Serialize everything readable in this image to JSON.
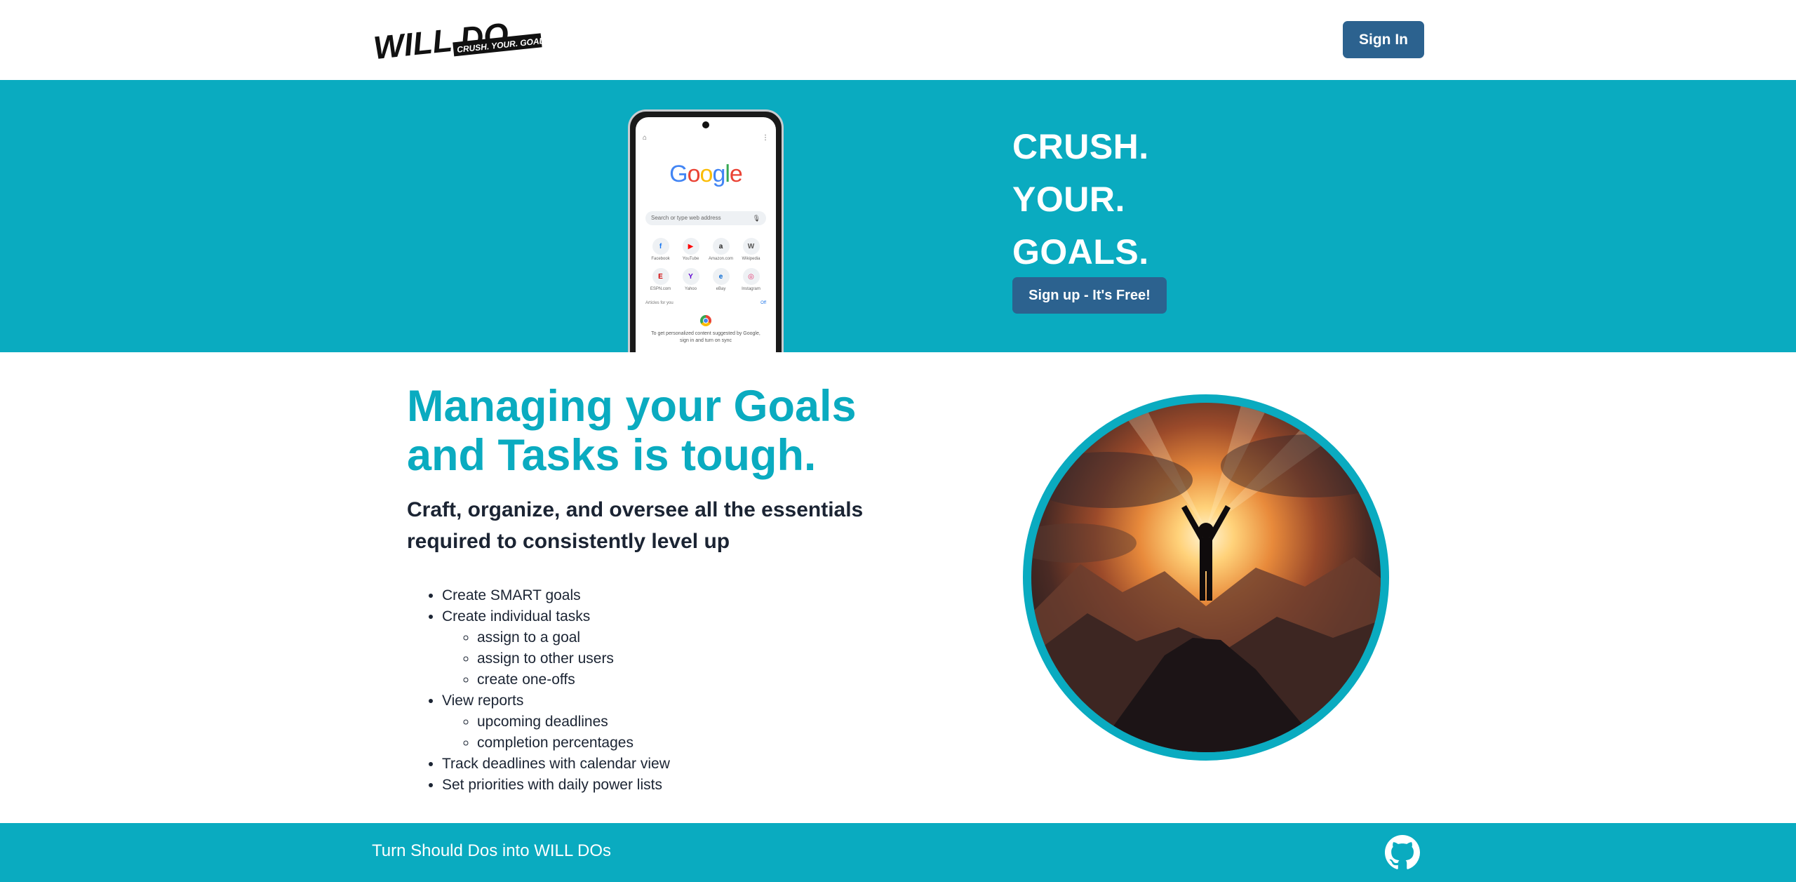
{
  "header": {
    "logo": {
      "name": "WILL DO",
      "tagline": "CRUSH. YOUR. GOALS."
    },
    "signin_label": "Sign In"
  },
  "hero": {
    "headline_lines": [
      "CRUSH.",
      "YOUR.",
      "GOALS."
    ],
    "signup_label": "Sign up - It's Free!",
    "phone": {
      "browser_logo": "Google",
      "search_placeholder": "Search or type web address",
      "shortcuts": [
        {
          "label": "Facebook",
          "glyph": "f",
          "color": "#1877f2"
        },
        {
          "label": "YouTube",
          "glyph": "▶",
          "color": "#ff0000"
        },
        {
          "label": "Amazon.com",
          "glyph": "a",
          "color": "#222222"
        },
        {
          "label": "Wikipedia",
          "glyph": "W",
          "color": "#555555"
        },
        {
          "label": "ESPN.com",
          "glyph": "E",
          "color": "#d00000"
        },
        {
          "label": "Yahoo",
          "glyph": "Y",
          "color": "#5f01d1"
        },
        {
          "label": "eBay",
          "glyph": "e",
          "color": "#0064d2"
        },
        {
          "label": "Instagram",
          "glyph": "◎",
          "color": "#e1306c"
        }
      ],
      "articles_label": "Articles for you",
      "articles_toggle": "Off",
      "personalize_text": "To get personalized content suggested by Google, sign in and turn on sync"
    }
  },
  "main": {
    "title": "Managing your Goals and Tasks is tough.",
    "subtitle": "Craft, organize, and oversee all the essentials required to consistently level up",
    "features": {
      "smart_goals": "Create SMART goals",
      "tasks": {
        "label": "Create individual tasks",
        "items": [
          "assign to a goal",
          "assign to other users",
          "create one-offs"
        ]
      },
      "reports": {
        "label": "View reports",
        "items": [
          "upcoming deadlines",
          "completion percentages"
        ]
      },
      "calendar": "Track deadlines with calendar view",
      "priorities": "Set priorities with daily power lists"
    }
  },
  "footer": {
    "tagline": "Turn Should Dos into WILL DOs",
    "github_icon": "github-icon"
  },
  "colors": {
    "accent": "#0aabc0",
    "button": "#2c628f",
    "text": "#1b2433",
    "white": "#ffffff"
  }
}
